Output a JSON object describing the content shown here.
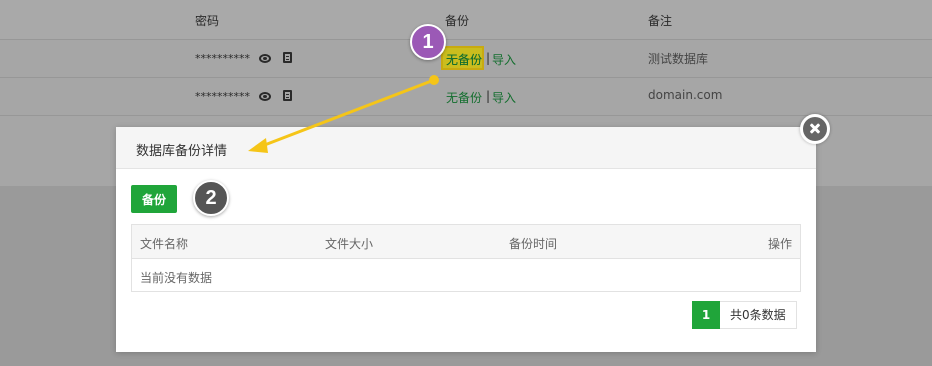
{
  "table": {
    "headers": {
      "password": "密码",
      "backup": "备份",
      "note": "备注"
    },
    "rows": [
      {
        "password": "**********",
        "backup_status": "无备份",
        "separator": "|",
        "import_label": "导入",
        "note": "测试数据库"
      },
      {
        "password": "**********",
        "backup_status": "无备份",
        "separator": "|",
        "import_label": "导入",
        "note": "domain.com"
      }
    ]
  },
  "annotations": {
    "step1": "1",
    "step2": "2",
    "highlight_color": "#cabd1e",
    "arrow_color": "#f5c518"
  },
  "modal": {
    "title": "数据库备份详情",
    "backup_button": "备份",
    "columns": {
      "name": "文件名称",
      "size": "文件大小",
      "time": "备份时间",
      "action": "操作"
    },
    "empty_text": "当前没有数据",
    "pagination": {
      "current_page": "1",
      "total_text": "共0条数据"
    }
  },
  "colors": {
    "accent": "#20a53a",
    "link_green": "#136e2e"
  }
}
